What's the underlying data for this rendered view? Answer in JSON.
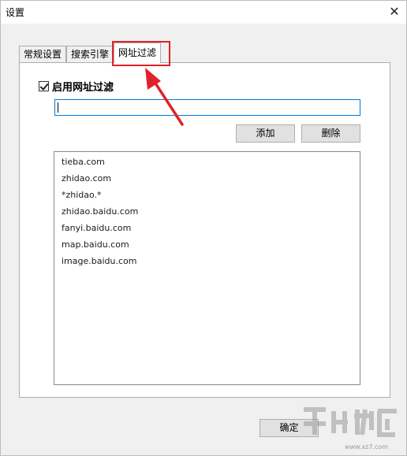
{
  "window": {
    "title": "设置",
    "close_glyph": "✕"
  },
  "tabs": [
    {
      "label": "常规设置",
      "active": false
    },
    {
      "label": "搜索引擎",
      "active": false
    },
    {
      "label": "网址过滤",
      "active": true
    }
  ],
  "filter": {
    "enable_label": "启用网址过滤",
    "enabled": true,
    "url_input_value": "",
    "add_label": "添加",
    "delete_label": "删除",
    "urls": [
      "tieba.com",
      "zhidao.com",
      "*zhidao.*",
      "zhidao.baidu.com",
      "fanyi.baidu.com",
      "map.baidu.com",
      "image.baidu.com"
    ]
  },
  "footer": {
    "ok_label": "确定"
  },
  "colors": {
    "highlight": "#e0222a",
    "arrow": "#e0222a",
    "input_focus": "#0078d7"
  }
}
